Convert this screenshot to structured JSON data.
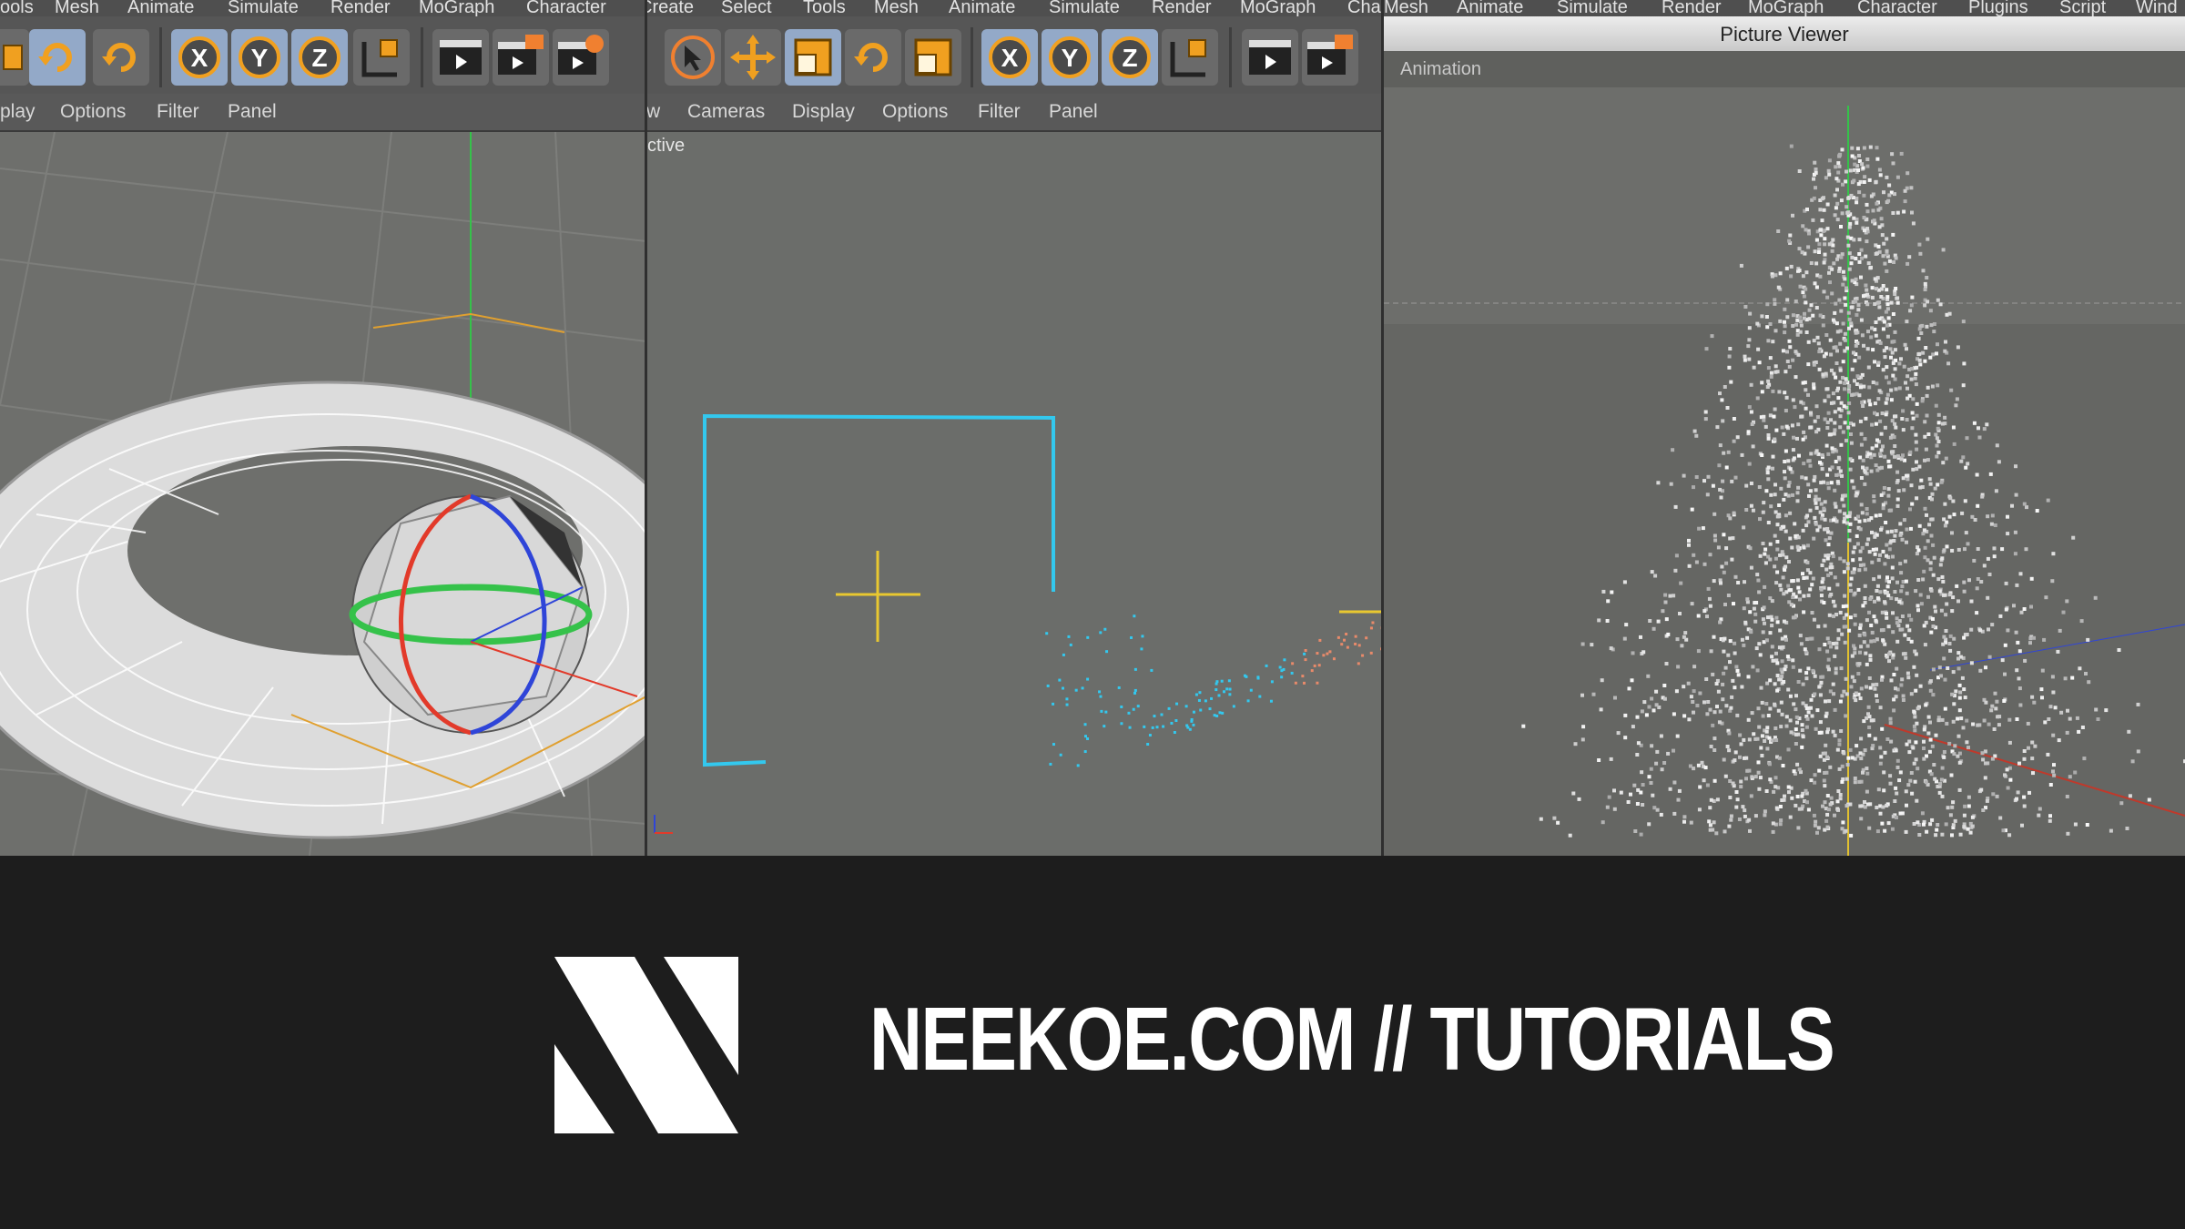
{
  "left_menu": [
    "ools",
    "Mesh",
    "Animate",
    "Simulate",
    "Render",
    "MoGraph",
    "Character"
  ],
  "mid_menu": [
    "Create",
    "Select",
    "Tools",
    "Mesh",
    "Animate",
    "Simulate",
    "Render",
    "MoGraph",
    "Cha"
  ],
  "right_menu": [
    "Mesh",
    "Animate",
    "Simulate",
    "Render",
    "MoGraph",
    "Character",
    "Plugins",
    "Script",
    "Wind"
  ],
  "left_viewport_menu": [
    "play",
    "Options",
    "Filter",
    "Panel"
  ],
  "mid_viewport_menu": [
    "w",
    "Cameras",
    "Display",
    "Options",
    "Filter",
    "Panel"
  ],
  "mid_viewport_label": "ctive",
  "picture_viewer": {
    "title": "Picture Viewer",
    "tab": "Animation"
  },
  "toolbar_icons": [
    "move-tool-icon",
    "scale-tool-icon",
    "rotate-tool-icon",
    "x-axis-lock-icon",
    "y-axis-lock-icon",
    "z-axis-lock-icon",
    "coordinate-system-icon",
    "render-view-icon",
    "render-picture-viewer-icon",
    "render-settings-icon",
    "select-tool-icon"
  ],
  "brand": {
    "text": "NEEKOE.COM // TUTORIALS",
    "logo": "N"
  },
  "colors": {
    "brand_bg": "#1d1d1d",
    "viewport_bg": "#6b6d6a",
    "spline": "#33c8ee",
    "axis_x": "#e23a2a",
    "axis_y": "#35c24a",
    "axis_z": "#2f45d8",
    "icon_orange": "#f0a020"
  }
}
